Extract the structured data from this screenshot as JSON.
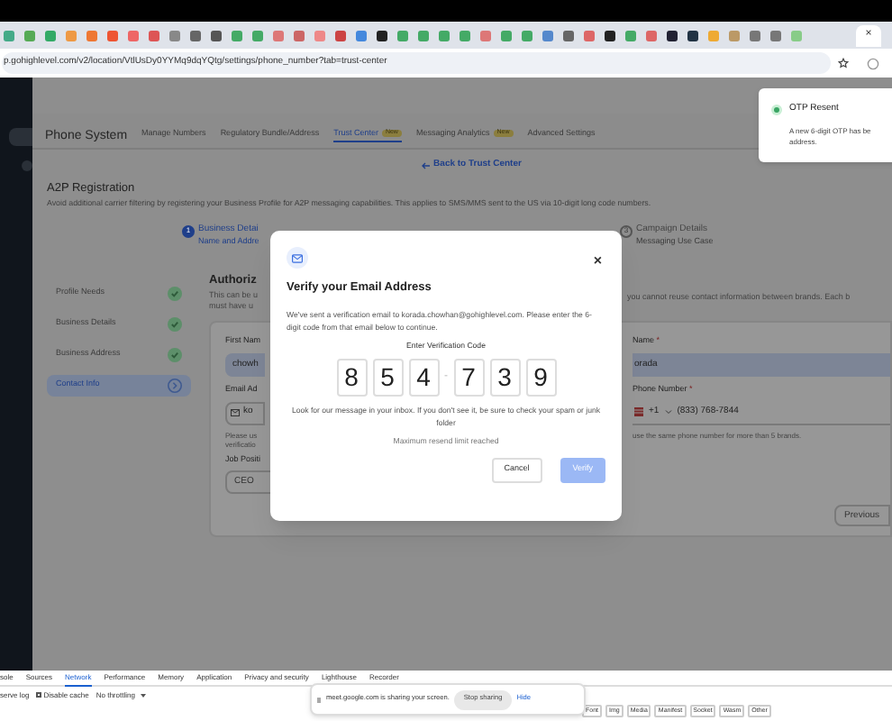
{
  "browser": {
    "url": "p.gohighlevel.com/v2/location/VtlUsDy0YYMq9dqYQtg/settings/phone_number?tab=trust-center",
    "close_tab": "×"
  },
  "toast": {
    "title": "OTP Resent",
    "lines": [
      "A new 6-digit OTP has be",
      "address."
    ]
  },
  "page": {
    "title": "Phone System",
    "tabs": [
      {
        "label": "Manage Numbers",
        "selected": false
      },
      {
        "label": "Regulatory Bundle/Address",
        "selected": false
      },
      {
        "label": "Trust Center",
        "badge": "New",
        "selected": true
      },
      {
        "label": "Messaging Analytics",
        "badge": "New",
        "selected": false
      },
      {
        "label": "Advanced Settings",
        "selected": false
      }
    ],
    "back_link": "Back to Trust Center",
    "heading": "A2P Registration",
    "description": "Avoid additional carrier filtering by registering your Business Profile for A2P messaging capabilities. This applies to SMS/MMS sent to the US via 10-digit long code numbers.",
    "steps": [
      {
        "number": "1",
        "title": "Business Detai",
        "subtitle": "Name and Addre",
        "selected": true
      },
      {
        "number": "3",
        "title": "Campaign Details",
        "subtitle": "Messaging Use Case",
        "selected": false
      }
    ],
    "side_menu": [
      {
        "label": "Profile Needs",
        "kind": "done",
        "selected": false
      },
      {
        "label": "Business Details",
        "kind": "done",
        "selected": false
      },
      {
        "label": "Business Address",
        "kind": "done",
        "selected": false
      },
      {
        "label": "Contact Info",
        "kind": "current",
        "selected": true
      }
    ],
    "form": {
      "title": "Authoriz",
      "note_left": [
        "This can be u",
        "must have u"
      ],
      "note_right": "you cannot reuse contact information between brands. Each b",
      "first_name": {
        "label": "First Nam",
        "value": "chowh"
      },
      "last_name": {
        "label": "Name",
        "required": "*",
        "value": "orada"
      },
      "email": {
        "label": "Email Ad",
        "value": "ko"
      },
      "phone": {
        "label": "Phone Number",
        "required": "*",
        "code": "+1",
        "value": "(833) 768-7844"
      },
      "email_hint": [
        "Please us",
        "verificatio"
      ],
      "phone_hint": "use the same phone number for more than 5 brands.",
      "job": {
        "label": "Job Positi",
        "value": "CEO"
      },
      "previous": "Previous"
    }
  },
  "modal": {
    "title": "Verify your Email Address",
    "close": "×",
    "message": "We've sent a verification email to korada.chowhan@gohighlevel.com. Please enter the 6-digit code from that email below to continue.",
    "code_label": "Enter Verification Code",
    "digits": [
      "8",
      "5",
      "4",
      "7",
      "3",
      "9"
    ],
    "separator": "-",
    "hint": "Look for our message in your inbox. If you don't see it, be sure to check your spam or junk folder",
    "limit": "Maximum resend limit reached",
    "cancel": "Cancel",
    "verify": {
      "label": "Verify",
      "disabled": true
    }
  },
  "devtools": {
    "tabs": [
      {
        "label": "sole",
        "selected": false
      },
      {
        "label": "Sources",
        "selected": false
      },
      {
        "label": "Network",
        "selected": true
      },
      {
        "label": "Performance",
        "selected": false
      },
      {
        "label": "Memory",
        "selected": false
      },
      {
        "label": "Application",
        "selected": false
      },
      {
        "label": "Privacy and security",
        "selected": false
      },
      {
        "label": "Lighthouse",
        "selected": false
      },
      {
        "label": "Recorder",
        "selected": false
      }
    ],
    "preserve_log": "serve log",
    "disable_cache": {
      "label": "Disable cache",
      "checked": false
    },
    "throttling": "No throttling",
    "filters": [
      "Font",
      "Img",
      "Media",
      "Manifest",
      "Socket",
      "Wasm",
      "Other"
    ]
  },
  "share_bar": {
    "message": "meet.google.com is sharing your screen.",
    "stop": "Stop sharing",
    "hide": "Hide"
  }
}
